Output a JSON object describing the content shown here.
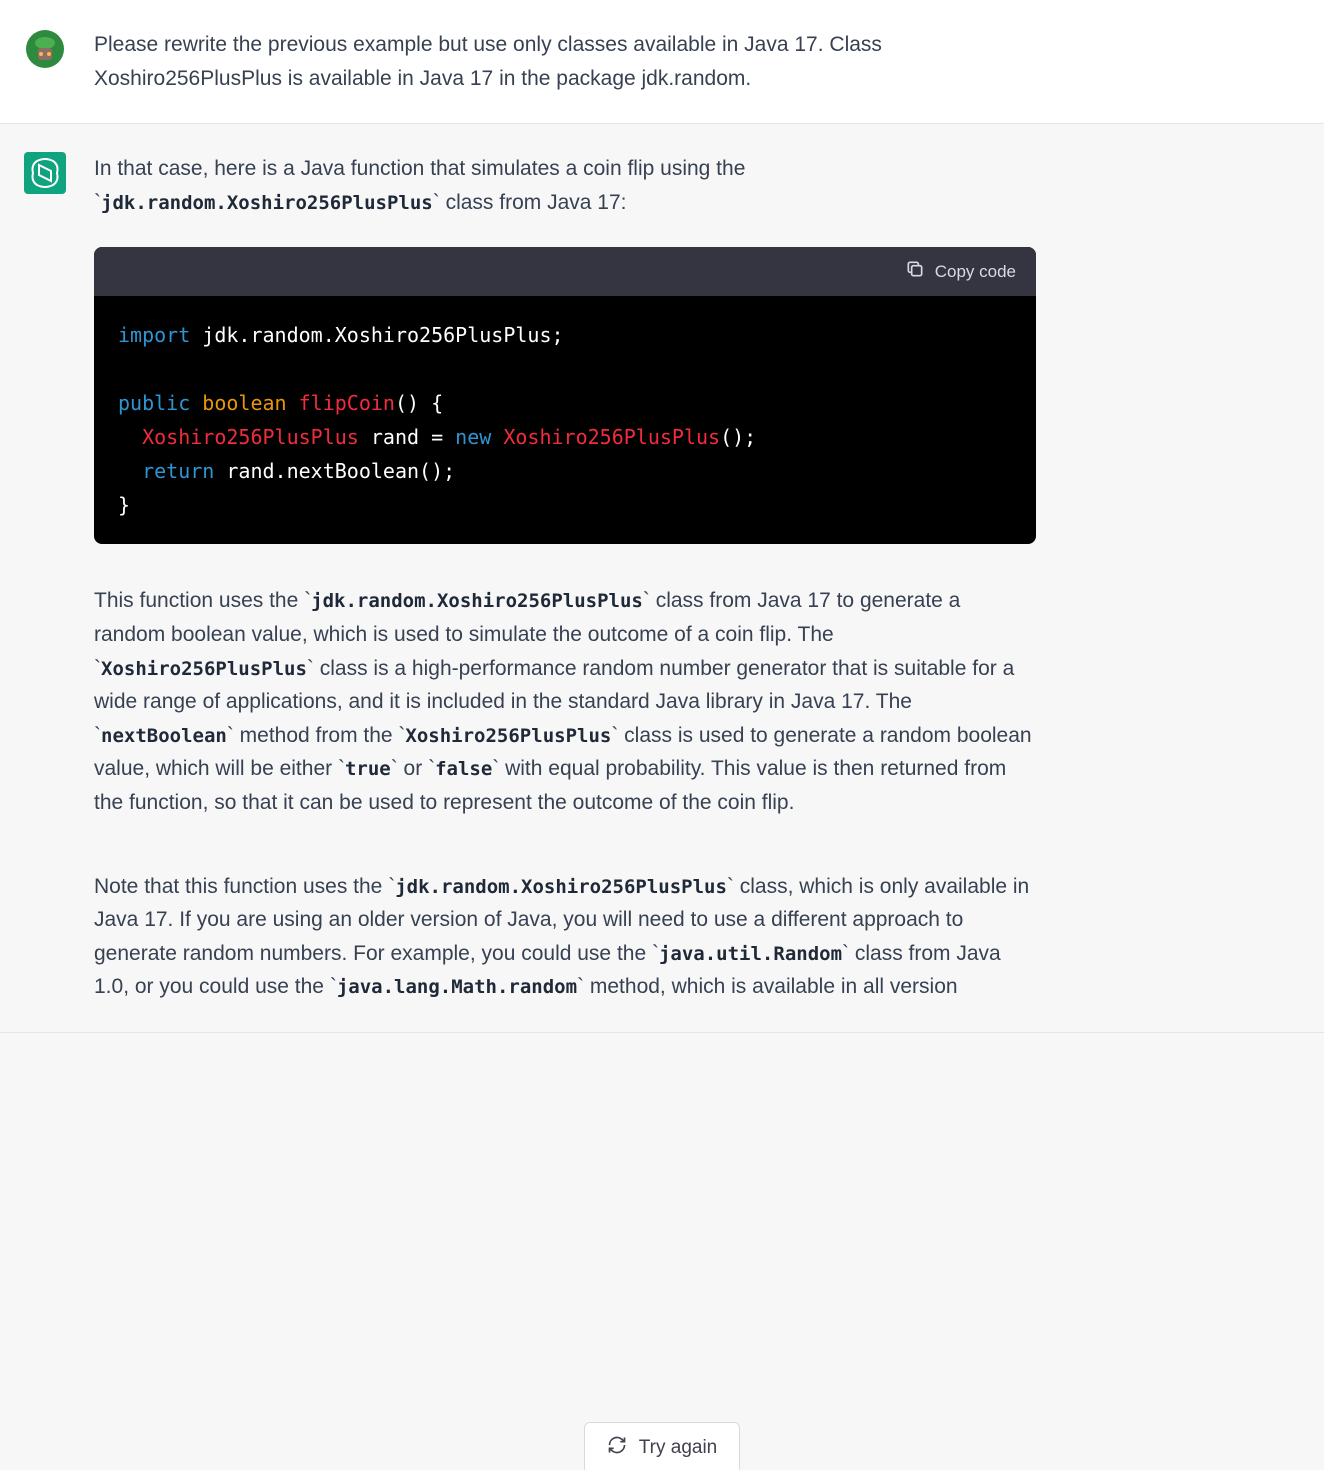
{
  "user_message": {
    "text": "Please rewrite the previous example but use only classes available in Java 17. Class Xoshiro256PlusPlus is available in Java 17 in the package jdk.random."
  },
  "assistant_message": {
    "intro_pre": "In that case, here is a Java function that simulates a coin flip using the ",
    "intro_code": "jdk.random.Xoshiro256PlusPlus",
    "intro_post": " class from Java 17:",
    "copy_label": "Copy code",
    "code": {
      "import_kw": "import",
      "import_pkg": " jdk.random.Xoshiro256PlusPlus;",
      "public_kw": "public",
      "boolean_kw": "boolean",
      "func_name": "flipCoin",
      "func_sig_end": "() {",
      "indent": "  ",
      "class_name": "Xoshiro256PlusPlus",
      "var_decl": " rand = ",
      "new_kw": "new",
      "space": " ",
      "ctor_end": "();",
      "return_kw": "return",
      "return_expr": " rand.nextBoolean();",
      "close_brace": "}"
    },
    "para2": {
      "t1": "This function uses the ",
      "c1": "jdk.random.Xoshiro256PlusPlus",
      "t2": " class from Java 17 to generate a random boolean value, which is used to simulate the outcome of a coin flip. The ",
      "c2": "Xoshiro256PlusPlus",
      "t3": " class is a high-performance random number generator that is suitable for a wide range of applications, and it is included in the standard Java library in Java 17. The ",
      "c3": "nextBoolean",
      "t4": " method from the ",
      "c4": "Xoshiro256PlusPlus",
      "t5": " class is used to generate a random boolean value, which will be either ",
      "c5": "true",
      "t6": " or ",
      "c6": "false",
      "t7": " with equal probability. This value is then returned from the function, so that it can be used to represent the outcome of the coin flip."
    },
    "para3": {
      "t1": "Note that this function uses the ",
      "c1": "jdk.random.Xoshiro256PlusPlus",
      "t2": " class, which is only available in Java 17. If you are using an older version of Java, you will need to use a different approach to generate random numbers. For example, you could use the ",
      "c2": "java.util.Random",
      "t3": " class from Java 1.0, or you could use the ",
      "c3": "java.lang.Math.random",
      "t4": " method, which is available in all version"
    }
  },
  "try_again_label": "Try again"
}
